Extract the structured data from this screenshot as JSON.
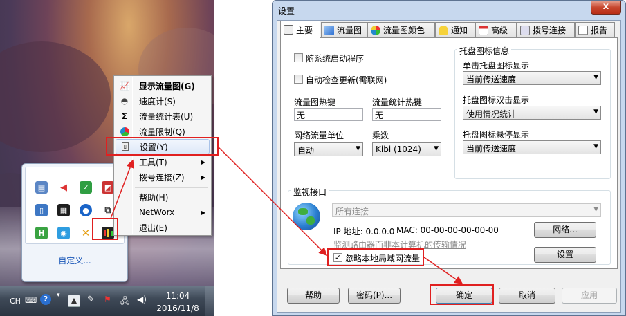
{
  "tray_popup": {
    "customize_label": "自定义..."
  },
  "context_menu": {
    "items": [
      {
        "label": "显示流量图(G)",
        "icon": "chart-icon",
        "bold": true
      },
      {
        "label": "速度计(S)",
        "icon": "speedometer-icon"
      },
      {
        "label": "流量统计表(U)",
        "icon": "sigma-icon"
      },
      {
        "label": "流量限制(Q)",
        "icon": "pie-icon"
      },
      {
        "label": "设置(Y)",
        "icon": "settings-icon",
        "highlighted": true
      },
      {
        "label": "工具(T)",
        "submenu": true
      },
      {
        "label": "拨号连接(Z)",
        "submenu": true
      },
      {
        "label": "帮助(H)"
      },
      {
        "label": "NetWorx",
        "submenu": true
      },
      {
        "label": "退出(E)"
      }
    ]
  },
  "taskbar": {
    "lang": "CH",
    "time": "11:04",
    "date": "2016/11/8"
  },
  "dialog": {
    "title": "设置",
    "close_glyph": "x",
    "tabs": [
      {
        "label": "主要",
        "icon": "main-icon",
        "active": true
      },
      {
        "label": "流量图",
        "icon": "graph-icon"
      },
      {
        "label": "流量图颜色",
        "icon": "palette-icon"
      },
      {
        "label": "通知",
        "icon": "bulb-icon"
      },
      {
        "label": "高级",
        "icon": "calendar-icon"
      },
      {
        "label": "拨号连接",
        "icon": "dialup-icon"
      },
      {
        "label": "报告",
        "icon": "report-icon"
      }
    ],
    "main": {
      "startup_label": "随系统启动程序",
      "startup_checked": false,
      "autoupdate_label": "自动检查更新(需联网)",
      "autoupdate_checked": false,
      "hotkey_graph_label": "流量图热键",
      "hotkey_graph_value": "无",
      "hotkey_stats_label": "流量统计热键",
      "hotkey_stats_value": "无",
      "unit_label": "网络流量单位",
      "unit_value": "自动",
      "multiplier_label": "乘数",
      "multiplier_value": "Kibi (1024)",
      "tray_group_title": "托盘图标信息",
      "tray_single_click_label": "单击托盘图标显示",
      "tray_single_click_value": "当前传送速度",
      "tray_double_click_label": "托盘图标双击显示",
      "tray_double_click_value": "使用情况统计",
      "tray_hover_label": "托盘图标悬停显示",
      "tray_hover_value": "当前传送速度",
      "monitor_group_title": "监视接口",
      "interface_value": "所有连接",
      "ip_text": "IP 地址: 0.0.0.0",
      "mac_text": "MAC: 00-00-00-00-00-00",
      "router_link": "监测路由器而非本计算机的传输情况",
      "network_button": "网络...",
      "setup_button": "设置",
      "ignore_lan_label": "忽略本地局域网流量",
      "ignore_lan_checked": true,
      "check_glyph": "✓"
    },
    "buttons": {
      "help": "帮助",
      "password": "密码(P)...",
      "ok": "确定",
      "cancel": "取消",
      "apply": "应用"
    }
  },
  "colors": {
    "annotation_red": "#e02020",
    "link_blue": "#1a57b8"
  }
}
